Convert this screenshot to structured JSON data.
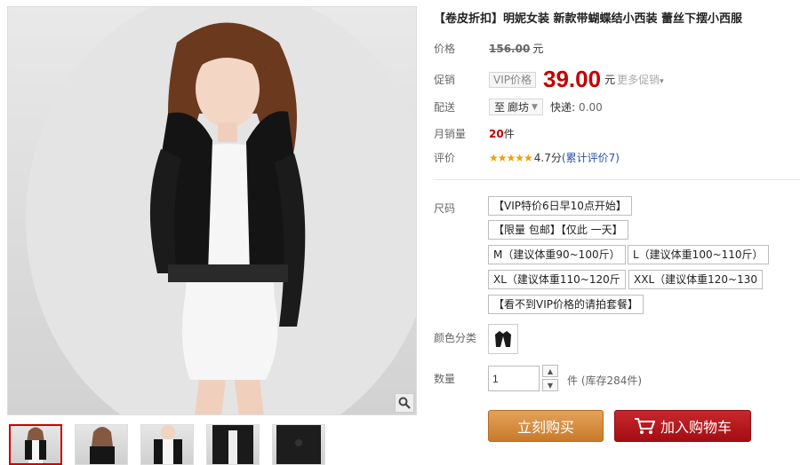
{
  "title": "【卷皮折扣】明妮女装 新款带蝴蝶结小西装 蕾丝下摆小西服",
  "price": {
    "label": "价格",
    "original": "156.00",
    "unit": "元"
  },
  "promo": {
    "label": "促销",
    "vip_tag": "VIP价格",
    "price": "39.00",
    "unit": "元",
    "more": "更多促销"
  },
  "shipping": {
    "label": "配送",
    "destination_prefix": "至",
    "destination": "廊坊",
    "method": "快递:",
    "fee": "0.00"
  },
  "sales": {
    "label": "月销量",
    "count": "20",
    "unit": "件"
  },
  "rating": {
    "label": "评价",
    "stars": "★★★★★",
    "score": "4.7分",
    "link_open": "(",
    "link": "累计评价7",
    "link_close": ")"
  },
  "size": {
    "label": "尺码",
    "options": [
      "【VIP特价6日早10点开始】",
      "【限量 包邮】【仅此 一天】",
      "M（建议体重90~100斤）",
      "L（建议体重100~110斤）",
      "XL（建议体重110~120斤",
      "XXL（建议体重120~130",
      "【看不到VIP价格的请拍套餐】"
    ]
  },
  "color": {
    "label": "颜色分类"
  },
  "quantity": {
    "label": "数量",
    "value": "1",
    "stock": "件 (库存284件)"
  },
  "actions": {
    "buy": "立刻购买",
    "cart": "加入购物车"
  },
  "icons": {
    "zoom": "magnifier-icon",
    "cart": "cart-icon",
    "up": "chevron-up-icon",
    "down": "chevron-down-icon"
  },
  "colors": {
    "price_red": "#c40000",
    "buy_orange": "#d58b3c",
    "cart_red": "#b5161b",
    "star": "#f2a000"
  }
}
